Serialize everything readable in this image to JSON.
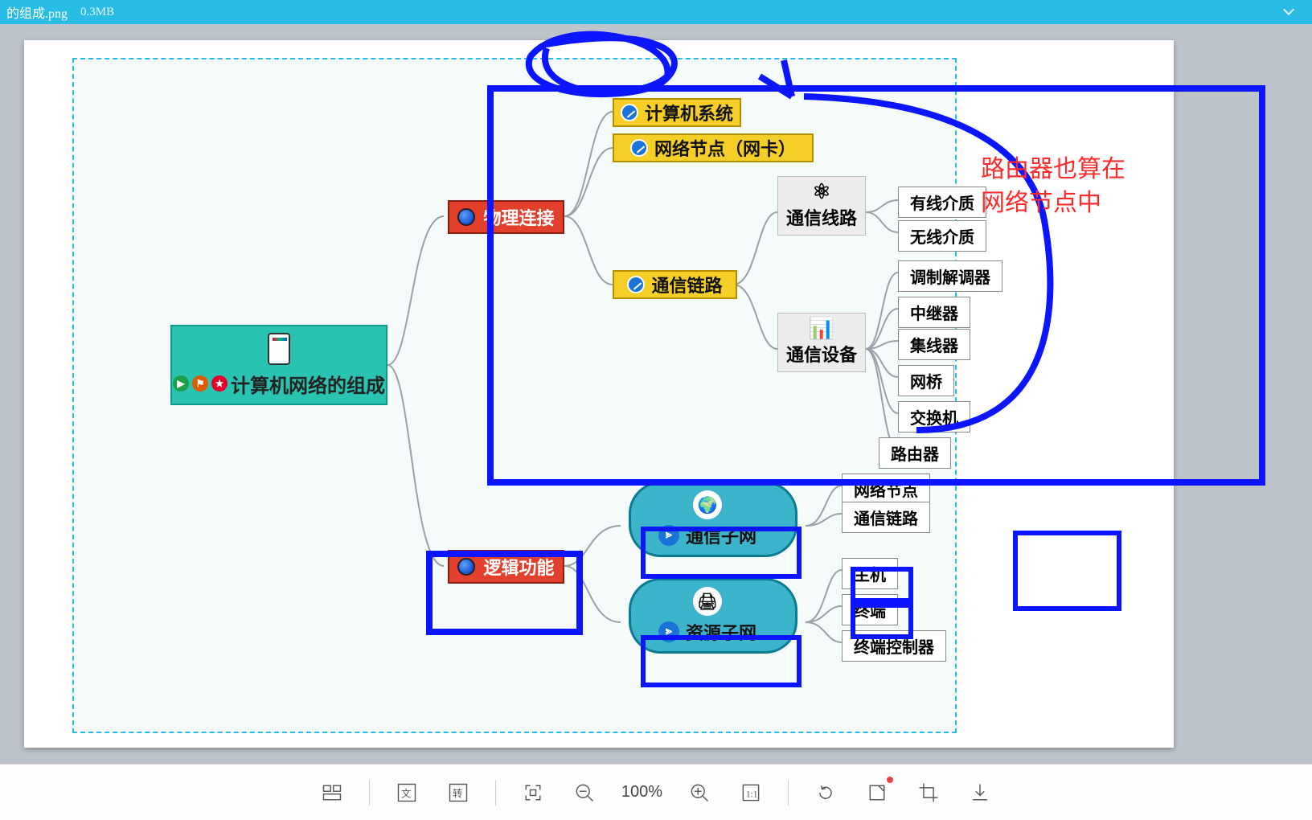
{
  "titlebar": {
    "filename": "的组成.png",
    "filesize": "0.3MB"
  },
  "toolbar": {
    "zoom": "100%"
  },
  "annotation": {
    "text_line1": "路由器也算在",
    "text_line2": "网络节点中"
  },
  "mindmap": {
    "root": "计算机网络的组成",
    "physical": {
      "label": "物理连接",
      "children": {
        "jisuanji": "计算机系统",
        "wangka": "网络节点（网卡）",
        "tongxinlianlu": "通信链路",
        "tongxinxianlu": "通信线路",
        "tongxinshebeibox": "通信设备",
        "youxian": "有线介质",
        "wuxian": "无线介质",
        "tiaozhijietiaoqi": "调制解调器",
        "zhongjiqi": "中继器",
        "jixianqi": "集线器",
        "wangqiao": "网桥",
        "jiaohuanji": "交换机",
        "luyouqi": "路由器"
      }
    },
    "logical": {
      "label": "逻辑功能",
      "tongxinziwang": "通信子网",
      "ziyuanziwang": "资源子网",
      "wangluojiedian": "网络节点",
      "tongxinlianlu2": "通信链路",
      "zhuji": "主机",
      "zhongduan": "终端",
      "zhongduankongzhiqi": "终端控制器"
    }
  }
}
